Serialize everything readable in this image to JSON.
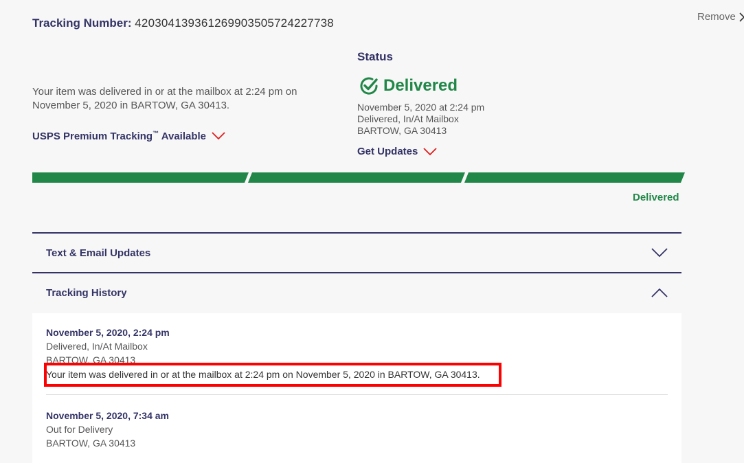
{
  "header": {
    "tracking_label": "Tracking Number:",
    "tracking_number": "420304139361269903505724227738",
    "remove_label": "Remove"
  },
  "summary": {
    "text": "Your item was delivered in or at the mailbox at 2:24 pm on November 5, 2020 in BARTOW, GA 30413.",
    "premium_label": "USPS Premium Tracking",
    "premium_tm": "™",
    "premium_suffix": "Available"
  },
  "status": {
    "heading": "Status",
    "state": "Delivered",
    "date": "November 5, 2020 at 2:24 pm",
    "detail": "Delivered, In/At Mailbox",
    "location": "BARTOW, GA 30413",
    "get_updates_label": "Get Updates"
  },
  "progress": {
    "segments_complete": 3,
    "segments_total": 3,
    "final_label": "Delivered",
    "color": "#218748"
  },
  "accordions": {
    "text_email": "Text & Email Updates",
    "history": "Tracking History"
  },
  "history": [
    {
      "time": "November 5, 2020, 2:24 pm",
      "status": "Delivered, In/At Mailbox",
      "location": "BARTOW, GA 30413",
      "note": "Your item was delivered in or at the mailbox at 2:24 pm on November 5, 2020 in BARTOW, GA 30413."
    },
    {
      "time": "November 5, 2020, 7:34 am",
      "status": "Out for Delivery",
      "location": "BARTOW, GA 30413"
    }
  ],
  "colors": {
    "navy": "#333366",
    "green": "#218748",
    "red": "#e31a1a",
    "highlight": "#ff0000"
  },
  "icons": [
    "chevron-right-icon",
    "check-circle-icon",
    "chevron-down-icon",
    "chevron-up-icon"
  ]
}
